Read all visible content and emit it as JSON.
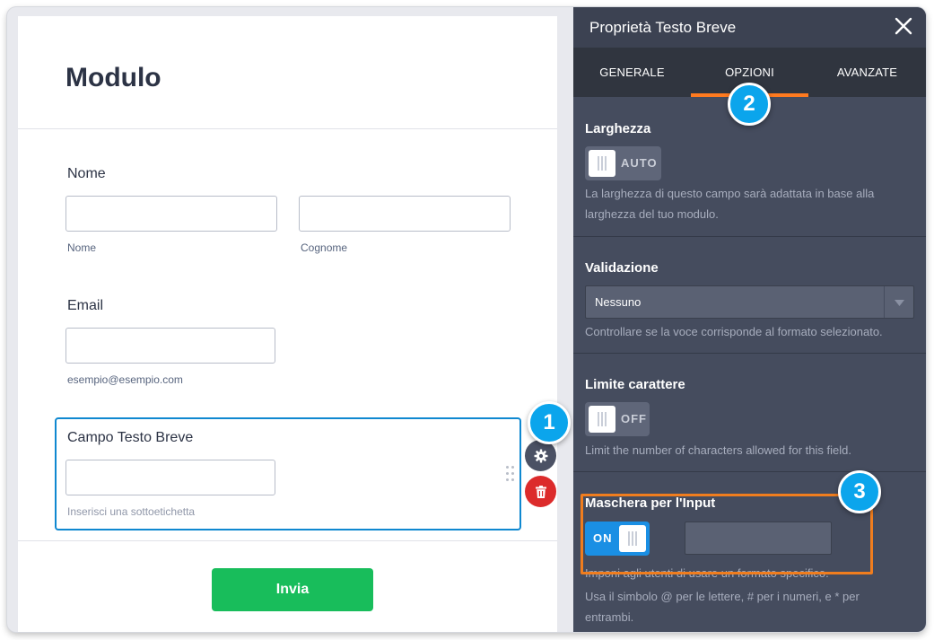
{
  "form": {
    "title": "Modulo",
    "name_field": {
      "label": "Nome",
      "first_sublabel": "Nome",
      "last_sublabel": "Cognome"
    },
    "email_field": {
      "label": "Email",
      "sublabel": "esempio@esempio.com"
    },
    "short_text_field": {
      "label": "Campo Testo Breve",
      "sublabel_placeholder": "Inserisci una sottoetichetta"
    },
    "submit_label": "Invia"
  },
  "field_actions": {
    "settings_icon": "gear-icon",
    "delete_icon": "trash-icon"
  },
  "panel": {
    "title": "Proprietà Testo Breve",
    "close_icon": "close-icon",
    "tabs": [
      {
        "label": "GENERALE",
        "active": false
      },
      {
        "label": "OPZIONI",
        "active": true
      },
      {
        "label": "AVANZATE",
        "active": false
      }
    ],
    "width": {
      "title": "Larghezza",
      "toggle_label": "AUTO",
      "description": "La larghezza di questo campo sarà adattata in base alla larghezza del tuo modulo."
    },
    "validation": {
      "title": "Validazione",
      "selected": "Nessuno",
      "description": "Controllare se la voce corrisponde al formato selezionato."
    },
    "char_limit": {
      "title": "Limite carattere",
      "toggle_label": "OFF",
      "description": "Limit the number of characters allowed for this field."
    },
    "input_mask": {
      "title": "Maschera per l'Input",
      "toggle_label": "ON",
      "mask_value": "",
      "description_1": "Imponi agli utenti di usare un formato specifico.",
      "description_2": "Usa il simbolo @ per le lettere, # per i numeri, e * per entrambi."
    }
  },
  "annotations": {
    "step_1": "1",
    "step_2": "2",
    "step_3": "3"
  },
  "colors": {
    "accent_tab": "#ff7a1f",
    "selection_border": "#0f88d0",
    "submit": "#18bd5b",
    "delete": "#dc2b2b",
    "toggle_on": "#1a8fe4",
    "badge": "#0ba5ec",
    "highlight": "#f07d1e"
  }
}
